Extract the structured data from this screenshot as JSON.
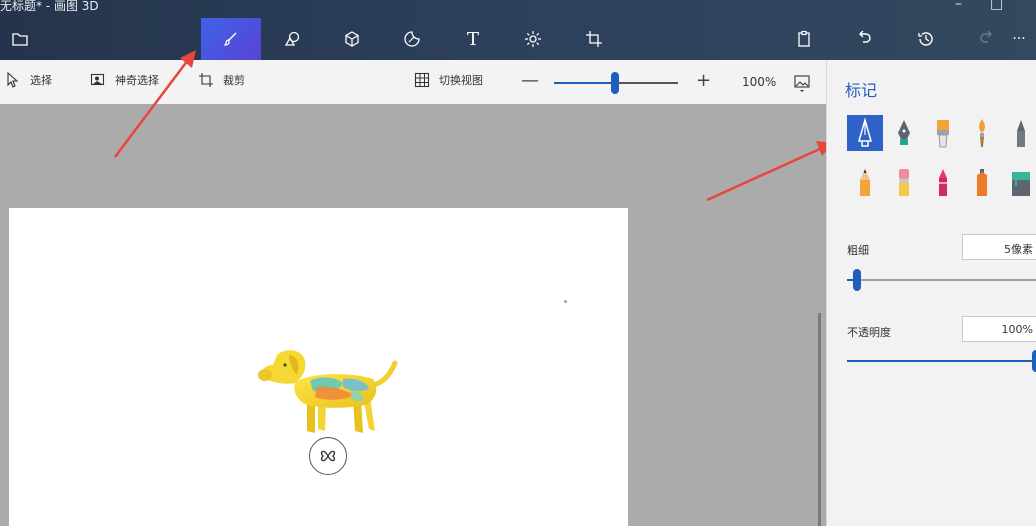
{
  "window": {
    "title": "无标题* - 画图 3D",
    "minimize": "–",
    "maximize": "□"
  },
  "toolbar": {
    "items": [
      {
        "name": "menu",
        "icon": "folder-icon"
      },
      {
        "name": "brushes",
        "icon": "brush-icon",
        "active": true
      },
      {
        "name": "2d-shapes",
        "icon": "shapes-2d-icon"
      },
      {
        "name": "3d-shapes",
        "icon": "cube-icon"
      },
      {
        "name": "stickers",
        "icon": "sticker-icon"
      },
      {
        "name": "text",
        "label": "T"
      },
      {
        "name": "effects",
        "icon": "sun-icon"
      },
      {
        "name": "canvas",
        "icon": "crop-canvas-icon"
      },
      {
        "name": "paste",
        "icon": "clipboard-icon"
      },
      {
        "name": "undo",
        "icon": "undo-icon"
      },
      {
        "name": "history",
        "icon": "history-icon"
      },
      {
        "name": "redo",
        "icon": "redo-icon",
        "disabled": true
      },
      {
        "name": "more",
        "label": "···"
      }
    ],
    "accent_color": "#3e63e6"
  },
  "subtoolbar": {
    "select_label": "选择",
    "magic_select_label": "神奇选择",
    "crop_label": "裁剪",
    "switch_view_label": "切换视图",
    "zoom_minus": "—",
    "zoom_plus": "+",
    "zoom_percent": "100%",
    "zoom_level": 0.49
  },
  "panel": {
    "title": "标记",
    "brushes": [
      {
        "name": "marker",
        "icon": "marker-icon",
        "selected": true
      },
      {
        "name": "calligraphy-pen",
        "icon": "calligraphy-pen-icon"
      },
      {
        "name": "oil-brush",
        "icon": "oil-brush-icon"
      },
      {
        "name": "watercolor",
        "icon": "watercolor-icon"
      },
      {
        "name": "pixel-pen",
        "icon": "pixel-pen-icon"
      },
      {
        "name": "pencil",
        "icon": "pencil-icon"
      },
      {
        "name": "eraser",
        "icon": "eraser-icon"
      },
      {
        "name": "crayon",
        "icon": "crayon-icon"
      },
      {
        "name": "spray-can",
        "icon": "spray-can-icon"
      },
      {
        "name": "fill",
        "icon": "fill-bucket-icon"
      }
    ],
    "thickness": {
      "label": "粗细",
      "value": "5像素",
      "level": 0.05
    },
    "opacity": {
      "label": "不透明度",
      "value": "100%",
      "level": 1.0
    },
    "accent_color": "#2f62c9"
  },
  "canvas": {
    "background": "#ffffff",
    "object": "dog-3d-model"
  },
  "annotations": {
    "arrow_color": "#e8453c"
  }
}
